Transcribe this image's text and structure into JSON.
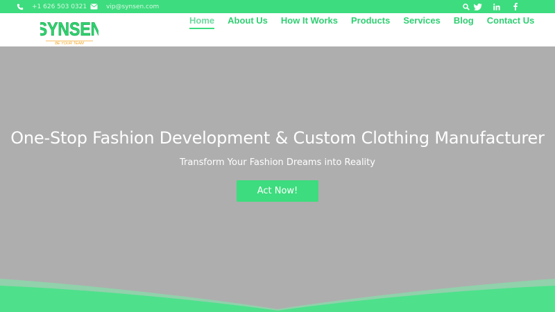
{
  "topbar": {
    "phone": "+1 626 503 0321",
    "email": "vip@synsen.com",
    "icons": [
      "phone-icon",
      "envelope-icon",
      "search-icon",
      "twitter-icon",
      "linkedin-icon",
      "facebook-icon"
    ]
  },
  "brand": {
    "name": "SYNSEN",
    "tagline": "BE YOUR TEAM"
  },
  "nav": {
    "items": [
      {
        "label": "Home",
        "active": true
      },
      {
        "label": "About Us"
      },
      {
        "label": "How It Works"
      },
      {
        "label": "Products"
      },
      {
        "label": "Services"
      },
      {
        "label": "Blog"
      },
      {
        "label": "Contact Us"
      }
    ]
  },
  "hero": {
    "title": "One-Stop Fashion Development & Custom Clothing Manufacturer",
    "subtitle": "Transform Your Fashion Dreams into Reality",
    "cta_label": "Act Now!"
  },
  "colors": {
    "accent": "#3ddc7e",
    "hero_bg": "#aeaeae",
    "logo_orange": "#f5a623"
  }
}
